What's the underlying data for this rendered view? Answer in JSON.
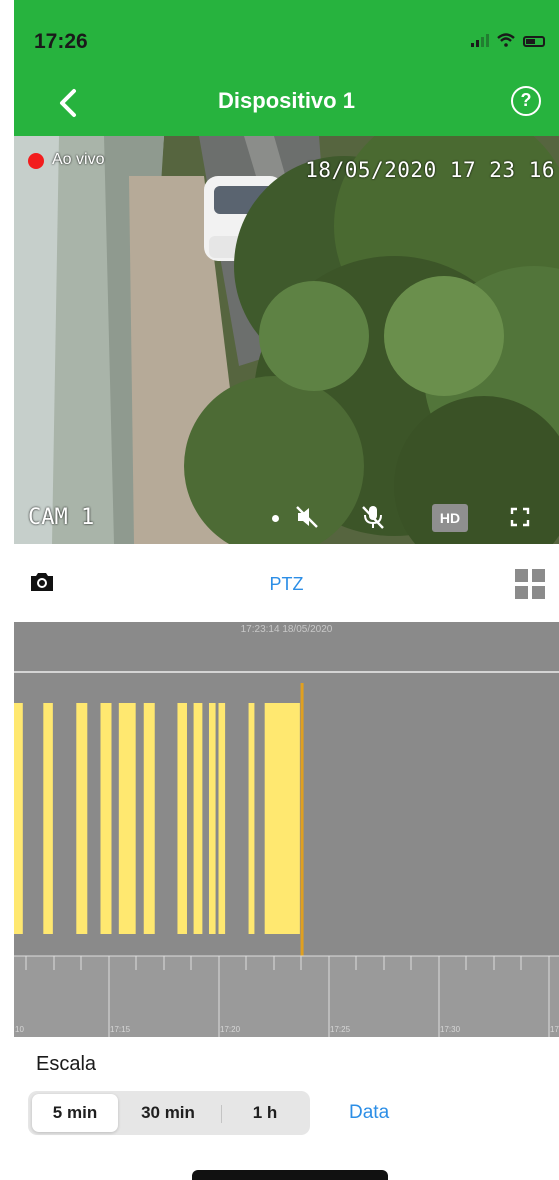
{
  "status_bar": {
    "time": "17:26"
  },
  "nav": {
    "title": "Dispositivo 1",
    "back_icon": "chevron-left-icon",
    "help_icon": "help-circle-icon",
    "help_glyph": "?"
  },
  "video": {
    "live_label": "Ao vivo",
    "osd_timestamp": "18/05/2020 17 23 16",
    "camera_label": "CAM 1",
    "hd_label": "HD",
    "controls": [
      "speaker-muted-icon",
      "mic-muted-icon",
      "hd-button",
      "fullscreen-icon"
    ]
  },
  "toolbar": {
    "ptz_label": "PTZ",
    "snapshot_icon": "camera-icon",
    "layout_icon": "grid-icon"
  },
  "timeline": {
    "current_time": "17:23:14 18/05/2020",
    "tick_labels": [
      "10",
      "17:15",
      "17:20",
      "17:25",
      "17:30",
      "17"
    ],
    "recording_segments": [
      [
        0,
        1.2
      ],
      [
        4,
        5.3
      ],
      [
        8.5,
        10
      ],
      [
        11.8,
        13.3
      ],
      [
        14.3,
        16.6
      ],
      [
        17.7,
        19.2
      ],
      [
        22.3,
        23.6
      ],
      [
        24.5,
        25.7
      ],
      [
        26.6,
        27.5
      ],
      [
        27.9,
        28.8
      ],
      [
        32,
        32.8
      ],
      [
        34.2,
        39
      ]
    ],
    "playhead_offset_min": 39.3
  },
  "scale": {
    "title": "Escala",
    "options": [
      "5 min",
      "30 min",
      "1 h"
    ],
    "selected": "5 min",
    "date_link": "Data"
  },
  "colors": {
    "accent": "#27b33e",
    "link": "#2c8ee6",
    "recording": "#ffe870",
    "playhead": "#e0a020",
    "timeline_bg": "#8a8a8a"
  }
}
